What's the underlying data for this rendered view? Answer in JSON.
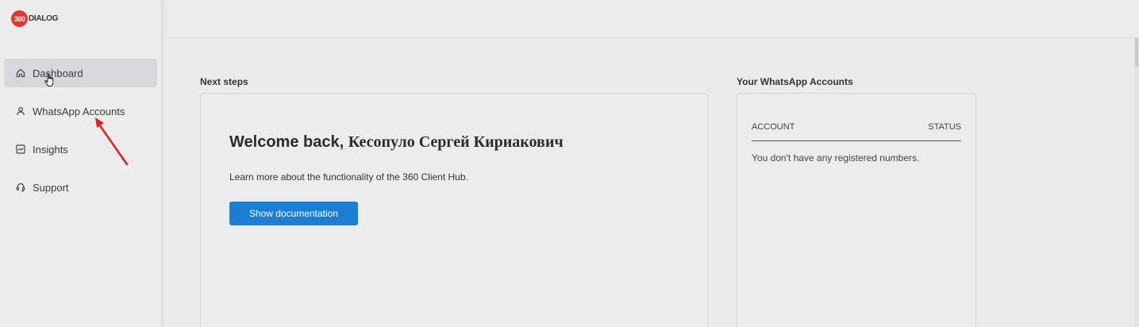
{
  "brand": {
    "logo_number": "360",
    "logo_text": "DIALOG",
    "logo_color": "#e4352f"
  },
  "sidebar": {
    "items": [
      {
        "label": "Dashboard",
        "icon": "home-icon",
        "active": true
      },
      {
        "label": "WhatsApp Accounts",
        "icon": "user-icon",
        "active": false
      },
      {
        "label": "Insights",
        "icon": "chart-icon",
        "active": false
      },
      {
        "label": "Support",
        "icon": "headset-icon",
        "active": false
      }
    ]
  },
  "main": {
    "next_steps": {
      "title": "Next steps",
      "welcome_prefix": "Welcome back,",
      "user_name": "Кесопуло Сергей Кириакович",
      "description": "Learn more about the functionality of the 360 Client Hub.",
      "button_label": "Show documentation",
      "button_color": "#1a7fd4"
    },
    "accounts": {
      "title": "Your WhatsApp Accounts",
      "columns": [
        "ACCOUNT",
        "STATUS"
      ],
      "empty_message": "You don't have any registered numbers."
    }
  },
  "annotation": {
    "arrow_color": "#e02020"
  }
}
